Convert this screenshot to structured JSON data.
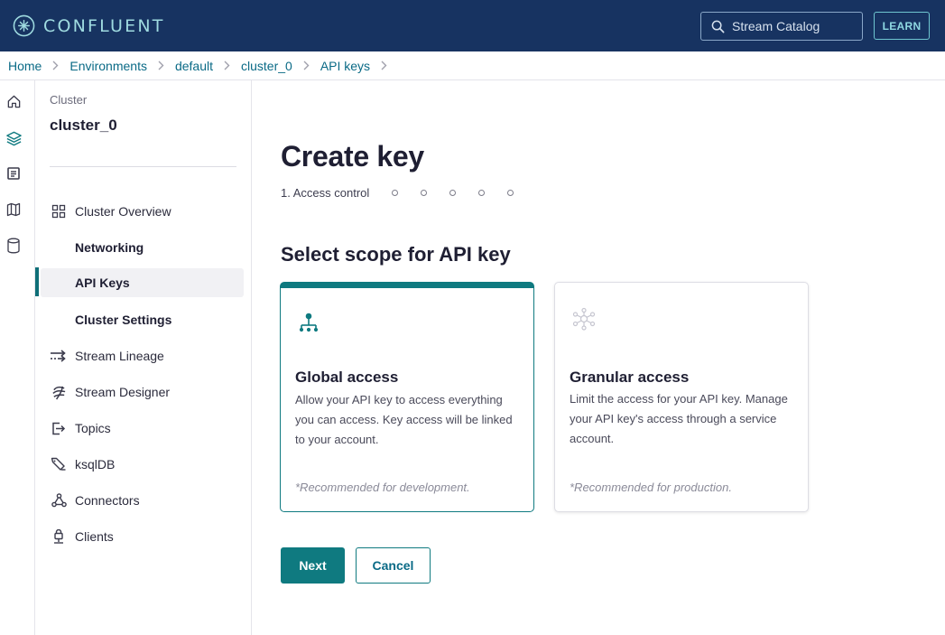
{
  "header": {
    "logo_text": "CONFLUENT",
    "search_label": "Stream Catalog",
    "learn_label": "LEARN"
  },
  "breadcrumb": [
    "Home",
    "Environments",
    "default",
    "cluster_0",
    "API keys"
  ],
  "rail_icons": [
    "home-icon",
    "layers-icon",
    "document-icon",
    "map-icon",
    "database-icon"
  ],
  "sidebar": {
    "cluster_label": "Cluster",
    "cluster_name": "cluster_0",
    "items": [
      {
        "label": "Cluster Overview",
        "icon": "grid-icon"
      },
      {
        "label": "Networking"
      },
      {
        "label": "API Keys"
      },
      {
        "label": "Cluster Settings"
      },
      {
        "label": "Stream Lineage",
        "icon": "lineage-icon"
      },
      {
        "label": "Stream Designer",
        "icon": "designer-icon"
      },
      {
        "label": "Topics",
        "icon": "topics-icon"
      },
      {
        "label": "ksqlDB",
        "icon": "ksqldb-icon"
      },
      {
        "label": "Connectors",
        "icon": "connectors-icon"
      },
      {
        "label": "Clients",
        "icon": "clients-icon"
      }
    ]
  },
  "main": {
    "title": "Create key",
    "step_label": "1. Access control",
    "section_title": "Select scope for API key",
    "cards": [
      {
        "title": "Global access",
        "description": "Allow your API key to access everything you can access. Key access will be linked to your account.",
        "note": "*Recommended for development.",
        "icon": "hierarchy-icon"
      },
      {
        "title": "Granular access",
        "description": "Limit the access for your API key. Manage your API key's access through a service account.",
        "note": "*Recommended for production.",
        "icon": "network-icon"
      }
    ],
    "next_label": "Next",
    "cancel_label": "Cancel"
  },
  "colors": {
    "header_bg": "#173361",
    "accent": "#0f7a80",
    "link": "#0a6a86"
  }
}
